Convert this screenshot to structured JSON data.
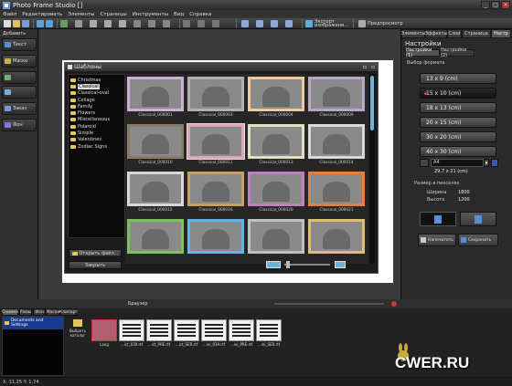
{
  "app": {
    "title": "Photo Frame Studio []"
  },
  "menu": [
    "Файл",
    "Редактировать",
    "Элементы",
    "Страницы",
    "Инструменты",
    "Вид",
    "Справка"
  ],
  "toolbar": {
    "export_label_1": "Экспорт",
    "export_label_2": "изображени...",
    "preview_label": "Предпросмотр"
  },
  "left_panel": {
    "header": "Добавить",
    "items": [
      {
        "label": "Текст",
        "color": "#5a8fd8"
      },
      {
        "label": "Маски",
        "color": "#c5b04a"
      },
      {
        "label": "",
        "color": "#6fb26f"
      },
      {
        "label": "",
        "color": "#6fb2d8"
      },
      {
        "label": "Заказ",
        "color": "#6f9bd8"
      },
      {
        "label": "Фон",
        "color": "#7b7bd8"
      }
    ]
  },
  "dialog": {
    "title": "Шаблоны",
    "folders": [
      "Christmas",
      "Classical",
      "Classical-oval",
      "Collage",
      "Family",
      "Flowers",
      "Miscellaneous",
      "Polaroid",
      "Simple",
      "Valentines",
      "Zodiac Signs"
    ],
    "selected_folder": "Classical",
    "open_file_label": "Открыть файл...",
    "close_label": "Закрыть",
    "thumbnails": [
      {
        "label": "Classical_000001",
        "frame": "#c8b0d8"
      },
      {
        "label": "Classical_000003",
        "frame": "#b0b0b0"
      },
      {
        "label": "Classical_000004",
        "frame": "#f0c8a0"
      },
      {
        "label": "Classical_000009",
        "frame": "#b8a8c8"
      },
      {
        "label": "Classical_000010",
        "frame": "#8a7a6a"
      },
      {
        "label": "Classical_000011",
        "frame": "#d8a8b8"
      },
      {
        "label": "Classical_000013",
        "frame": "#e0e0c0"
      },
      {
        "label": "Classical_000014",
        "frame": "#d8d8d8"
      },
      {
        "label": "Classical_000015",
        "frame": "#d8d8d8"
      },
      {
        "label": "Classical_000016",
        "frame": "#c8a060"
      },
      {
        "label": "Classical_000020",
        "frame": "#c080c0"
      },
      {
        "label": "Classical_000021",
        "frame": "#e08040"
      },
      {
        "label": "",
        "frame": "#80c060"
      },
      {
        "label": "",
        "frame": "#60b8e0"
      },
      {
        "label": "",
        "frame": "#c0c0c0"
      },
      {
        "label": "",
        "frame": "#d8c070"
      }
    ]
  },
  "right_panel": {
    "tabs": [
      "Элементы",
      "Эффекты",
      "Слои",
      "Страница",
      "Настр"
    ],
    "header": "Настройки",
    "subtabs": [
      "Настройки (1)",
      "Настройки (2)"
    ],
    "format_label": "Выбор формата",
    "sizes": [
      "13 x 9 (cm)",
      "15 x 10 (cm)",
      "18 x 13 (cm)",
      "20 x 15 (cm)",
      "30 x 20 (cm)",
      "40 x 30 (cm)"
    ],
    "selected_size": "15 x 10 (cm)",
    "paper_value": "A4",
    "paper_dims": "29,7 x 21 (cm)",
    "pixel_size_label": "Размер в пикселях",
    "width_label": "Ширина",
    "width_value": "1800",
    "height_label": "Высота",
    "height_value": "1200",
    "print_label": "Напечатать",
    "save_label": "Сохранить"
  },
  "bottom": {
    "tabs": [
      "Снимки",
      "Рамы",
      "Фон",
      "Маски",
      "Клипарт"
    ],
    "browser_tab": "Браузер",
    "tree_item": "Documents and Settings",
    "folder_item": "Выбрать каталог",
    "files": [
      "Lang",
      "...ict_039.rtf",
      "...ict_PRE.rtf",
      "...ict_SER.rtf",
      "...ini_039.rtf",
      "...ini_PRE.rtf",
      "...ini_SER.rtf"
    ]
  },
  "status": {
    "text": "X: 11,25 Y: 1,74"
  },
  "watermark": {
    "text": "CWER.RU"
  }
}
